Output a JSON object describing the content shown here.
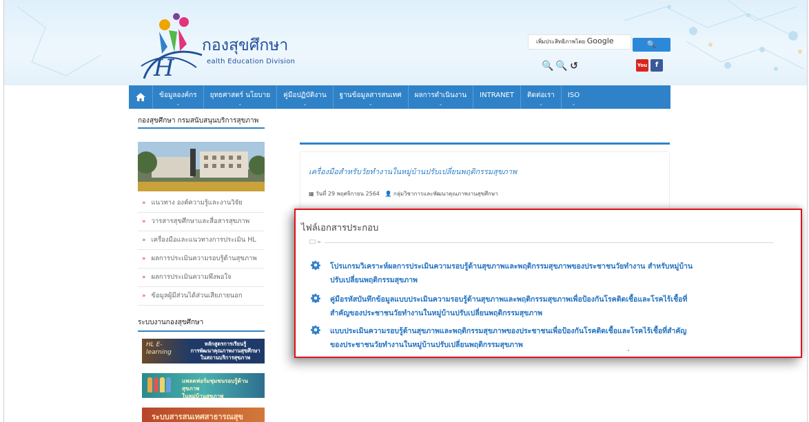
{
  "header": {
    "logo_title": "กองสุขศึกษา",
    "logo_subtitle": "ealth Education Division",
    "search_label": "เพิ่มประสิทธิภาพโดย",
    "search_brand": "Google",
    "search_button": "🔍",
    "zoom_out": "🔍",
    "zoom_in": "🔍",
    "zoom_reset": "↺",
    "social_youtube": "You",
    "social_facebook": "f",
    "colors": {
      "nav": "#2f82c8",
      "accent_red": "#e0111b",
      "link": "#2473c2"
    }
  },
  "nav": {
    "home_icon": "home-icon",
    "items": [
      {
        "label": "ข้อมูลองค์กร"
      },
      {
        "label": "ยุทธศาสตร์ นโยบาย"
      },
      {
        "label": "คู่มือปฏิบัติงาน"
      },
      {
        "label": "ฐานข้อมูลสารสนเทศ"
      },
      {
        "label": "ผลการดำเนินงาน"
      },
      {
        "label": "INTRANET"
      },
      {
        "label": "ติดต่อเรา"
      },
      {
        "label": "ISO"
      }
    ]
  },
  "sidebar": {
    "heading": "กองสุขศึกษา กรมสนับสนุนบริการสุขภาพ",
    "items": [
      {
        "label": "แนวทาง องค์ความรู้และงานวิจัย"
      },
      {
        "label": "วารสารสุขศึกษาและสื่อสารสุขภาพ"
      },
      {
        "label": "เครื่องมือและแนวทางการประเมิน HL"
      },
      {
        "label": "ผลการประเมินความรอบรู้ด้านสุขภาพ"
      },
      {
        "label": "ผลการประเมินความพึงพอใจ"
      },
      {
        "label": "ข้อมูลผู้มีส่วนได้ส่วนเสียภายนอก"
      }
    ],
    "heading2": "ระบบงานกองสุขศึกษา",
    "banners": [
      {
        "line1": "หลักสูตรการเรียนรู้",
        "line2": "การพัฒนาคุณภาพงานสุขศึกษา",
        "line3": "ในสถานบริการสุขภาพ",
        "badge": "HL E-learning"
      },
      {
        "line1": "แพลตฟอร์มชุมชนรอบรู้ด้านสุขภาพ",
        "line2": "ในหมู่บ้านสุขภาพ"
      },
      {
        "line1": "ระบบสารสนเทศสาธารณสุข"
      }
    ]
  },
  "article": {
    "title": "เครื่องมือสำหรับวัยทำงานในหมู่บ้านปรับเปลี่ยนพฤติกรรมสุขภาพ",
    "date": "วันที่ 29 พฤศจิกายน 2564",
    "author": "กลุ่มวิชาการและพัฒนาคุณภาพงานสุขศึกษา"
  },
  "attachments": {
    "title": "ไฟล์เอกสารประกอบ",
    "items": [
      {
        "line1": "โปรแกรมวิเคราะห์ผลการประเมินความรอบรู้ด้านสุขภาพและพฤติกรรมสุขภาพของประชาชนวัยทำงาน สำหรับหมู่บ้าน",
        "line2": "ปรับเปลี่ยนพฤติกรรมสุขภาพ"
      },
      {
        "line1": "คู่มือรหัสบันทึกข้อมูลแบบประเมินความรอบรู้ด้านสุขภาพและพฤติกรรมสุขภาพเพื่อป้องกันโรคติดเชื้อและโรคไร้เชื้อที่",
        "line2": "สำคัญของประชาชนวัยทำงานในหมู่บ้านปรับเปลี่ยนพฤติกรรมสุขภาพ"
      },
      {
        "line1": "แบบประเมินความรอบรู้ด้านสุขภาพและพฤติกรรมสุขภาพของประชาชนเพื่อป้องกันโรคติดเชื้อและโรคไร้เชื้อที่สำคัญ",
        "line2": "ของประชาชนวัยทำงานในหมู่บ้านปรับเปลี่ยนพฤติกรรมสุขภาพ"
      }
    ]
  }
}
